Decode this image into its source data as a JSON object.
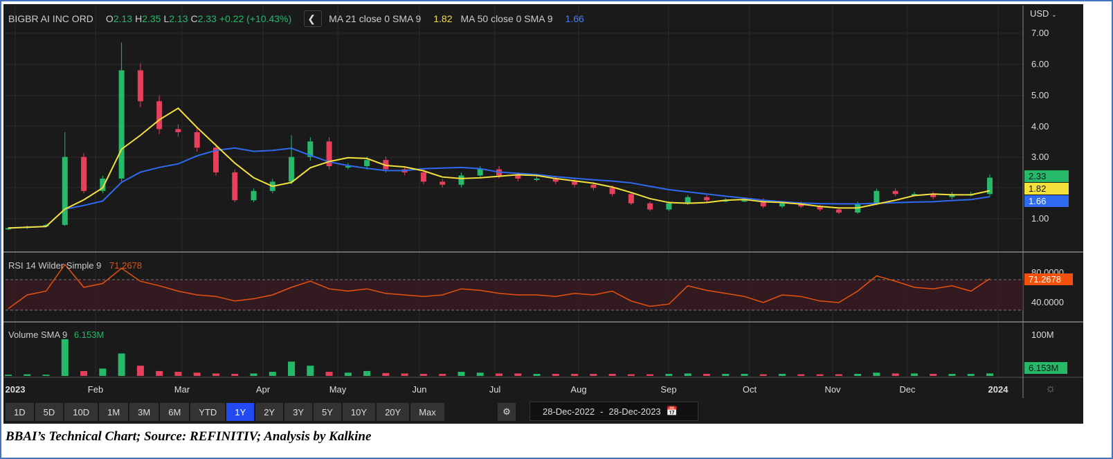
{
  "header": {
    "symbol": "BIGBR AI INC ORD",
    "o_label": "O",
    "o": "2.13",
    "h_label": "H",
    "h": "2.35",
    "l_label": "L",
    "l": "2.13",
    "c_label": "C",
    "c": "2.33",
    "change": "+0.22 (+10.43%)",
    "ma21_label": "MA 21 close 0 SMA 9",
    "ma21_value": "1.82",
    "ma50_label": "MA 50 close 0 SMA 9",
    "ma50_value": "1.66"
  },
  "currency": "USD",
  "price_ticks": [
    "7.00",
    "6.00",
    "5.00",
    "4.00",
    "3.00",
    "1.00"
  ],
  "tags": {
    "close": "2.33",
    "ma21": "1.82",
    "ma50": "1.66",
    "rsi": "71.2678",
    "volume": "6.153M"
  },
  "rsi": {
    "label": "RSI 14 Wilder Simple 9",
    "value": "71.2678",
    "ticks": [
      "80.0000",
      "40.0000"
    ]
  },
  "volume": {
    "label": "Volume SMA 9",
    "value": "6.153M",
    "tick": "100M"
  },
  "months": [
    "2023",
    "Feb",
    "Mar",
    "Apr",
    "May",
    "Jun",
    "Jul",
    "Aug",
    "Sep",
    "Oct",
    "Nov",
    "Dec",
    "2024"
  ],
  "ranges": [
    "1D",
    "5D",
    "10D",
    "1M",
    "3M",
    "6M",
    "YTD",
    "1Y",
    "2Y",
    "3Y",
    "5Y",
    "10Y",
    "20Y",
    "Max"
  ],
  "active_range": "1Y",
  "date_from": "28-Dec-2022",
  "date_sep": "-",
  "date_to": "28-Dec-2023",
  "caption": "BBAI’s Technical Chart; Source: REFINITIV; Analysis by Kalkine",
  "colors": {
    "up": "#26b96a",
    "down": "#e8405a",
    "ma21": "#f5e13c",
    "ma50": "#2f6bf0",
    "rsi": "#e8520f"
  },
  "chart_data": {
    "type": "candlestick",
    "frequency": "weekly approx",
    "ylim": [
      0,
      7.6
    ],
    "closes": [
      0.7,
      0.75,
      0.8,
      3.0,
      1.9,
      2.3,
      5.8,
      4.8,
      3.9,
      3.8,
      3.3,
      2.5,
      1.6,
      1.9,
      2.2,
      3.0,
      3.5,
      2.7,
      2.7,
      2.9,
      2.6,
      2.5,
      2.2,
      2.1,
      2.4,
      2.6,
      2.4,
      2.3,
      2.3,
      2.2,
      2.1,
      2.0,
      1.8,
      1.5,
      1.3,
      1.5,
      1.7,
      1.6,
      1.6,
      1.6,
      1.4,
      1.5,
      1.4,
      1.3,
      1.2,
      1.5,
      1.9,
      1.8,
      1.8,
      1.7,
      1.8,
      1.8,
      2.33
    ],
    "highs_extra": {
      "3": 3.8,
      "6": 6.7,
      "15": 3.7
    },
    "ma21_weeks": 4,
    "ma50_weeks": 10,
    "rsi_values": [
      32,
      50,
      55,
      90,
      60,
      65,
      85,
      68,
      62,
      55,
      50,
      48,
      42,
      45,
      50,
      60,
      68,
      58,
      55,
      58,
      52,
      50,
      48,
      50,
      58,
      56,
      52,
      50,
      50,
      48,
      52,
      50,
      55,
      42,
      35,
      38,
      62,
      56,
      52,
      48,
      40,
      50,
      48,
      42,
      40,
      55,
      75,
      68,
      60,
      58,
      62,
      55,
      71.27
    ],
    "volume_m": [
      3,
      4,
      3,
      90,
      12,
      18,
      55,
      25,
      12,
      10,
      8,
      6,
      5,
      6,
      10,
      35,
      25,
      10,
      8,
      12,
      7,
      6,
      5,
      5,
      10,
      8,
      6,
      6,
      5,
      5,
      5,
      5,
      5,
      4,
      4,
      5,
      6,
      5,
      5,
      5,
      4,
      5,
      4,
      4,
      4,
      5,
      8,
      6,
      6,
      5,
      5,
      5,
      6.15
    ]
  }
}
